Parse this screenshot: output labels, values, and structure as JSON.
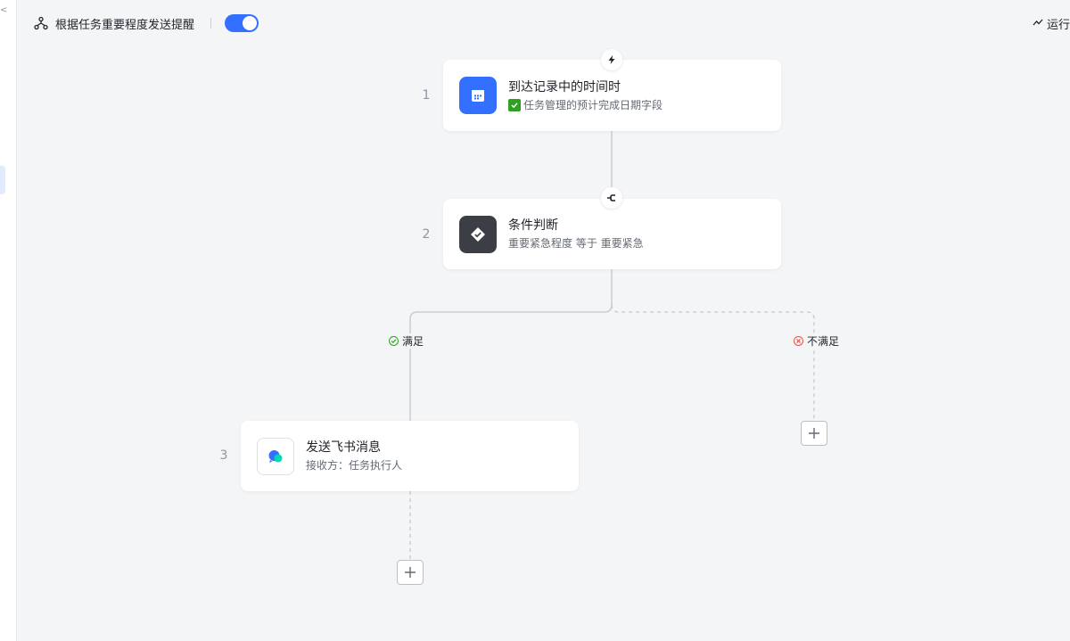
{
  "header": {
    "flow_title": "根据任务重要程度发送提醒",
    "enabled": true,
    "run_log_label": "运行"
  },
  "steps": [
    {
      "number": "1",
      "title": "到达记录中的时间时",
      "subtitle": "任务管理的预计完成日期字段",
      "icon": "calendar-icon",
      "icon_bg": "#3370ff",
      "badge_icon": "lightning-icon"
    },
    {
      "number": "2",
      "title": "条件判断",
      "subtitle": "重要紧急程度 等于 重要紧急",
      "icon": "diamond-check-icon",
      "icon_bg": "#3b3f45",
      "badge_icon": "branch-icon"
    },
    {
      "number": "3",
      "title": "发送飞书消息",
      "subtitle": "接收方：任务执行人",
      "icon": "chat-bubble-icon",
      "icon_bg": "#ffffff"
    }
  ],
  "branches": {
    "yes_label": "满足",
    "no_label": "不满足"
  },
  "colors": {
    "accent": "#3370ff",
    "success": "#2ea121",
    "danger": "#f54a45",
    "canvas_bg": "#f4f5f7"
  }
}
